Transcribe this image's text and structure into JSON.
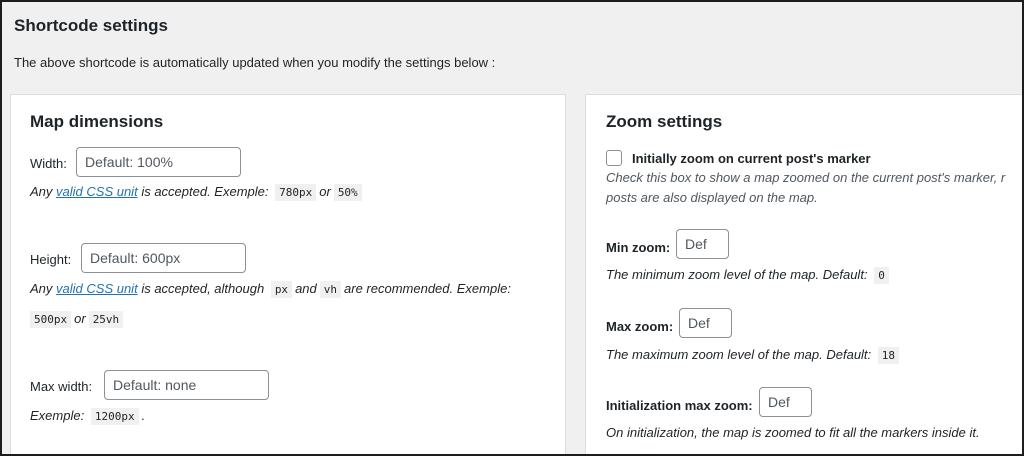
{
  "page": {
    "title": "Shortcode settings",
    "description": "The above shortcode is automatically updated when you modify the settings below :"
  },
  "map_dimensions": {
    "heading": "Map dimensions",
    "width": {
      "label": "Width:",
      "placeholder": "Default: 100%",
      "desc_prefix": "Any",
      "link_text": "valid CSS unit",
      "desc_middle": "is accepted. Exemple:",
      "code1": "780px",
      "or": "or",
      "code2": "50%"
    },
    "height": {
      "label": "Height:",
      "placeholder": "Default: 600px",
      "desc_prefix": "Any",
      "link_text": "valid CSS unit",
      "desc_middle": "is accepted, although",
      "code1": "px",
      "and": "and",
      "code2": "vh",
      "desc_suffix": "are recommended. Exemple:",
      "code3": "500px",
      "or": "or",
      "code4": "25vh"
    },
    "max_width": {
      "label": "Max width:",
      "placeholder": "Default: none",
      "desc_prefix": "Exemple:",
      "code1": "1200px",
      "desc_suffix": "."
    }
  },
  "zoom_settings": {
    "heading": "Zoom settings",
    "initial_zoom": {
      "label": "Initially zoom on current post's marker",
      "checked": false,
      "desc_line1": "Check this box to show a map zoomed on the current post's marker, r",
      "desc_line2": "posts are also displayed on the map."
    },
    "min_zoom": {
      "label": "Min zoom:",
      "placeholder": "Def",
      "desc": "The minimum zoom level of the map. Default:",
      "code": "0"
    },
    "max_zoom": {
      "label": "Max zoom:",
      "placeholder": "Def",
      "desc": "The maximum zoom level of the map. Default:",
      "code": "18"
    },
    "init_max_zoom": {
      "label": "Initialization max zoom:",
      "placeholder": "Def",
      "desc": "On initialization, the map is zoomed to fit all the markers inside it."
    }
  }
}
